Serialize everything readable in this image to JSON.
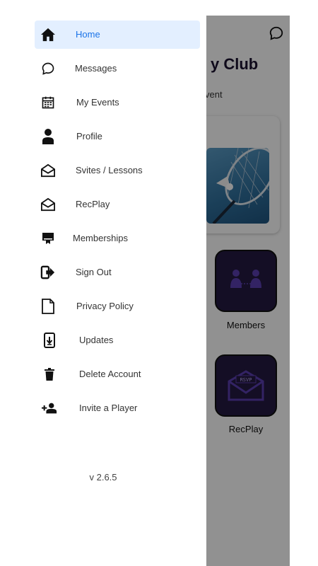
{
  "drawer": {
    "items": [
      {
        "label": "Home",
        "icon": "home-icon",
        "active": true
      },
      {
        "label": "Messages",
        "icon": "chat-bubble-icon"
      },
      {
        "label": "My Events",
        "icon": "calendar-icon"
      },
      {
        "label": "Profile",
        "icon": "person-icon"
      },
      {
        "label": "Svites / Lessons",
        "icon": "envelope-open-icon"
      },
      {
        "label": "RecPlay",
        "icon": "envelope-open-icon"
      },
      {
        "label": "Memberships",
        "icon": "card-membership-icon"
      },
      {
        "label": "Sign Out",
        "icon": "sign-out-icon"
      },
      {
        "label": "Privacy Policy",
        "icon": "document-icon"
      },
      {
        "label": "Updates",
        "icon": "phone-download-icon"
      },
      {
        "label": "Delete Account",
        "icon": "trash-icon"
      },
      {
        "label": "Invite a Player",
        "icon": "person-add-icon"
      }
    ],
    "version": "v 2.6.5"
  },
  "background": {
    "title_fragment": "y Club",
    "subtitle_fragment": "vent",
    "tiles": [
      {
        "label": "Members",
        "icon": "members-icon"
      },
      {
        "label": "RecPlay",
        "icon": "rsvp-envelope-icon",
        "badge": "RSVP"
      }
    ]
  },
  "colors": {
    "active_bg": "#e3efff",
    "active_text": "#1a73e8",
    "tile_bg": "#241a42",
    "tile_icon": "#5b3fb0"
  }
}
